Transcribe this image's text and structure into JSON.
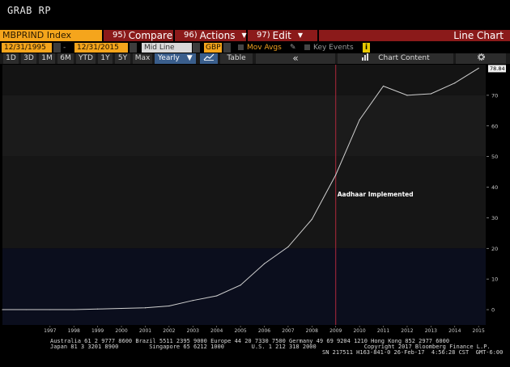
{
  "screen_title": "GRAB RP",
  "toolbar": {
    "ticker": "MBPRIND Index",
    "compare": {
      "num": "95)",
      "label": "Compare"
    },
    "actions": {
      "num": "96)",
      "label": "Actions",
      "caret": "▼"
    },
    "edit": {
      "num": "97)",
      "label": "Edit",
      "caret": "▼"
    },
    "chart_type": "Line Chart"
  },
  "controls": {
    "start_date": "12/31/1995",
    "end_date": "12/31/2015",
    "line_mode": "Mid Line",
    "currency": "GBP",
    "mov_avgs": "Mov Avgs",
    "key_events": "Key Events",
    "info": "i"
  },
  "periods": [
    "1D",
    "3D",
    "1M",
    "6M",
    "YTD",
    "1Y",
    "5Y",
    "Max"
  ],
  "frequency": "Yearly",
  "frequency_caret": "▼",
  "table_label": "Table",
  "collapse_label": "«",
  "chart_content_label": "Chart Content",
  "settings_icon": "gear-icon",
  "colors": {
    "accent": "#f5a51c",
    "button_red": "#8b1a1a",
    "line": "#d0d0d0",
    "event_line": "#b0283c"
  },
  "chart_data": {
    "type": "line",
    "x": [
      1995,
      1996,
      1997,
      1998,
      1999,
      2000,
      2001,
      2002,
      2003,
      2004,
      2005,
      2006,
      2007,
      2008,
      2009,
      2010,
      2011,
      2012,
      2013,
      2014,
      2015
    ],
    "values": [
      0,
      0,
      0,
      0,
      0.2,
      0.4,
      0.6,
      1.2,
      3,
      4.5,
      8,
      15,
      20.5,
      29.5,
      44,
      62,
      73,
      70,
      70.5,
      74,
      78.84
    ],
    "last_value_label": "78.84",
    "ylim": [
      -5,
      80
    ],
    "yticks": [
      0,
      10,
      20,
      30,
      40,
      50,
      60,
      70
    ],
    "xticks": [
      "1997",
      "1998",
      "1999",
      "2000",
      "2001",
      "2002",
      "2003",
      "2004",
      "2005",
      "2006",
      "2007",
      "2008",
      "2009",
      "2010",
      "2011",
      "2012",
      "2013",
      "2014",
      "2015"
    ],
    "annotation": {
      "x": 2009,
      "text": "Aadhaar Implemented"
    },
    "grid": false,
    "bands": true
  },
  "footer": {
    "line1": "Australia 61 2 9777 8600 Brazil 5511 2395 9000 Europe 44 20 7330 7500 Germany 49 69 9204 1210 Hong Kong 852 2977 6000",
    "line2": "Japan 81 3 3201 8900         Singapore 65 6212 1000        U.S. 1 212 318 2000              Copyright 2017 Bloomberg Finance L.P.",
    "line3": "SN 217511 H163-841-0 26-Feb-17  4:56:28 CST  GMT-6:00"
  }
}
